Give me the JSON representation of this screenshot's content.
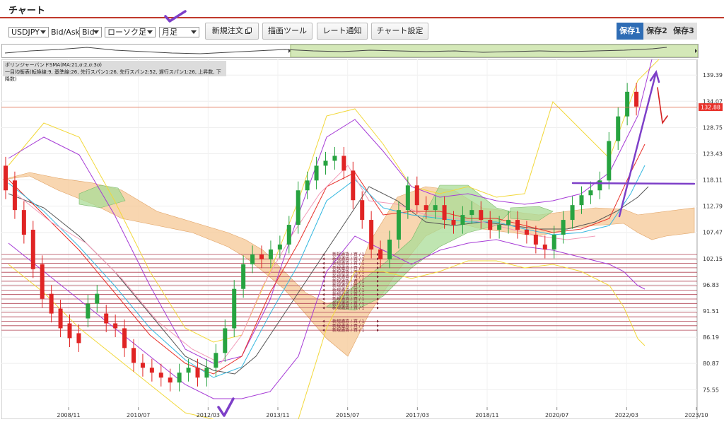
{
  "page": {
    "title": "チャート"
  },
  "toolbar": {
    "symbol": "USDJPY",
    "bidask_label": "Bid/Ask",
    "bidask": "Bid",
    "chart_type": "ローソク足",
    "period": "月足",
    "new_order": "新規注文",
    "drawing_tools": "描画ツール",
    "rate_alert": "レート通知",
    "chart_settings": "チャート設定",
    "saves": [
      "保存1",
      "保存2",
      "保存3"
    ]
  },
  "legend": {
    "line1": "ボリンジャーバンドSMA(MA:21,σ:2,σ:3σ)",
    "line2": "一目均衡表(転換線:9, 基準線:26, 先行スパン1:26, 先行スパン2:52, 遅行スパン1:26, 上昇数, 下降数)"
  },
  "order_label": "新規通貨 / 買 / 1",
  "chart_data": {
    "type": "candlestick",
    "y_ticks": [
      139.39,
      134.07,
      128.75,
      123.43,
      118.11,
      112.79,
      107.47,
      102.15,
      96.83,
      91.51,
      86.19,
      80.87,
      75.55
    ],
    "current_price": 132.88,
    "x_ticks": [
      "2008/11",
      "2010/07",
      "2012/03",
      "2013/11",
      "2015/07",
      "2017/03",
      "2018/11",
      "2020/07",
      "2022/03",
      "2023/10"
    ],
    "ylim": [
      72.0,
      142.0
    ],
    "candles": [
      [
        121,
        116
      ],
      [
        118,
        112
      ],
      [
        112,
        107
      ],
      [
        108,
        100
      ],
      [
        101,
        94
      ],
      [
        95,
        91
      ],
      [
        92,
        88
      ],
      [
        89,
        86
      ],
      [
        87,
        85
      ],
      [
        90,
        93
      ],
      [
        93,
        95
      ],
      [
        91,
        89
      ],
      [
        89,
        88
      ],
      [
        88,
        84
      ],
      [
        84,
        81
      ],
      [
        81,
        80
      ],
      [
        80,
        79
      ],
      [
        79,
        78
      ],
      [
        78,
        77
      ],
      [
        77,
        79
      ],
      [
        79,
        80
      ],
      [
        80,
        78
      ],
      [
        78,
        80
      ],
      [
        80,
        83
      ],
      [
        83,
        88
      ],
      [
        88,
        96
      ],
      [
        96,
        101
      ],
      [
        101,
        103
      ],
      [
        103,
        102
      ],
      [
        102,
        104
      ],
      [
        104,
        105
      ],
      [
        105,
        109
      ],
      [
        109,
        116
      ],
      [
        116,
        118
      ],
      [
        118,
        121
      ],
      [
        121,
        122
      ],
      [
        122,
        123
      ],
      [
        123,
        120
      ],
      [
        120,
        114
      ],
      [
        114,
        110
      ],
      [
        110,
        104
      ],
      [
        104,
        102
      ],
      [
        102,
        106
      ],
      [
        106,
        112
      ],
      [
        112,
        117
      ],
      [
        117,
        113
      ],
      [
        113,
        112
      ],
      [
        112,
        113
      ],
      [
        113,
        110
      ],
      [
        110,
        109
      ],
      [
        109,
        111
      ],
      [
        111,
        112
      ],
      [
        112,
        110
      ],
      [
        110,
        108
      ],
      [
        108,
        109
      ],
      [
        109,
        110
      ],
      [
        110,
        108
      ],
      [
        108,
        107
      ],
      [
        107,
        105
      ],
      [
        105,
        104
      ],
      [
        104,
        107
      ],
      [
        107,
        110
      ],
      [
        110,
        113
      ],
      [
        113,
        115
      ],
      [
        115,
        116
      ],
      [
        116,
        118
      ],
      [
        118,
        126
      ],
      [
        126,
        131
      ],
      [
        131,
        136
      ],
      [
        136,
        133
      ]
    ]
  }
}
